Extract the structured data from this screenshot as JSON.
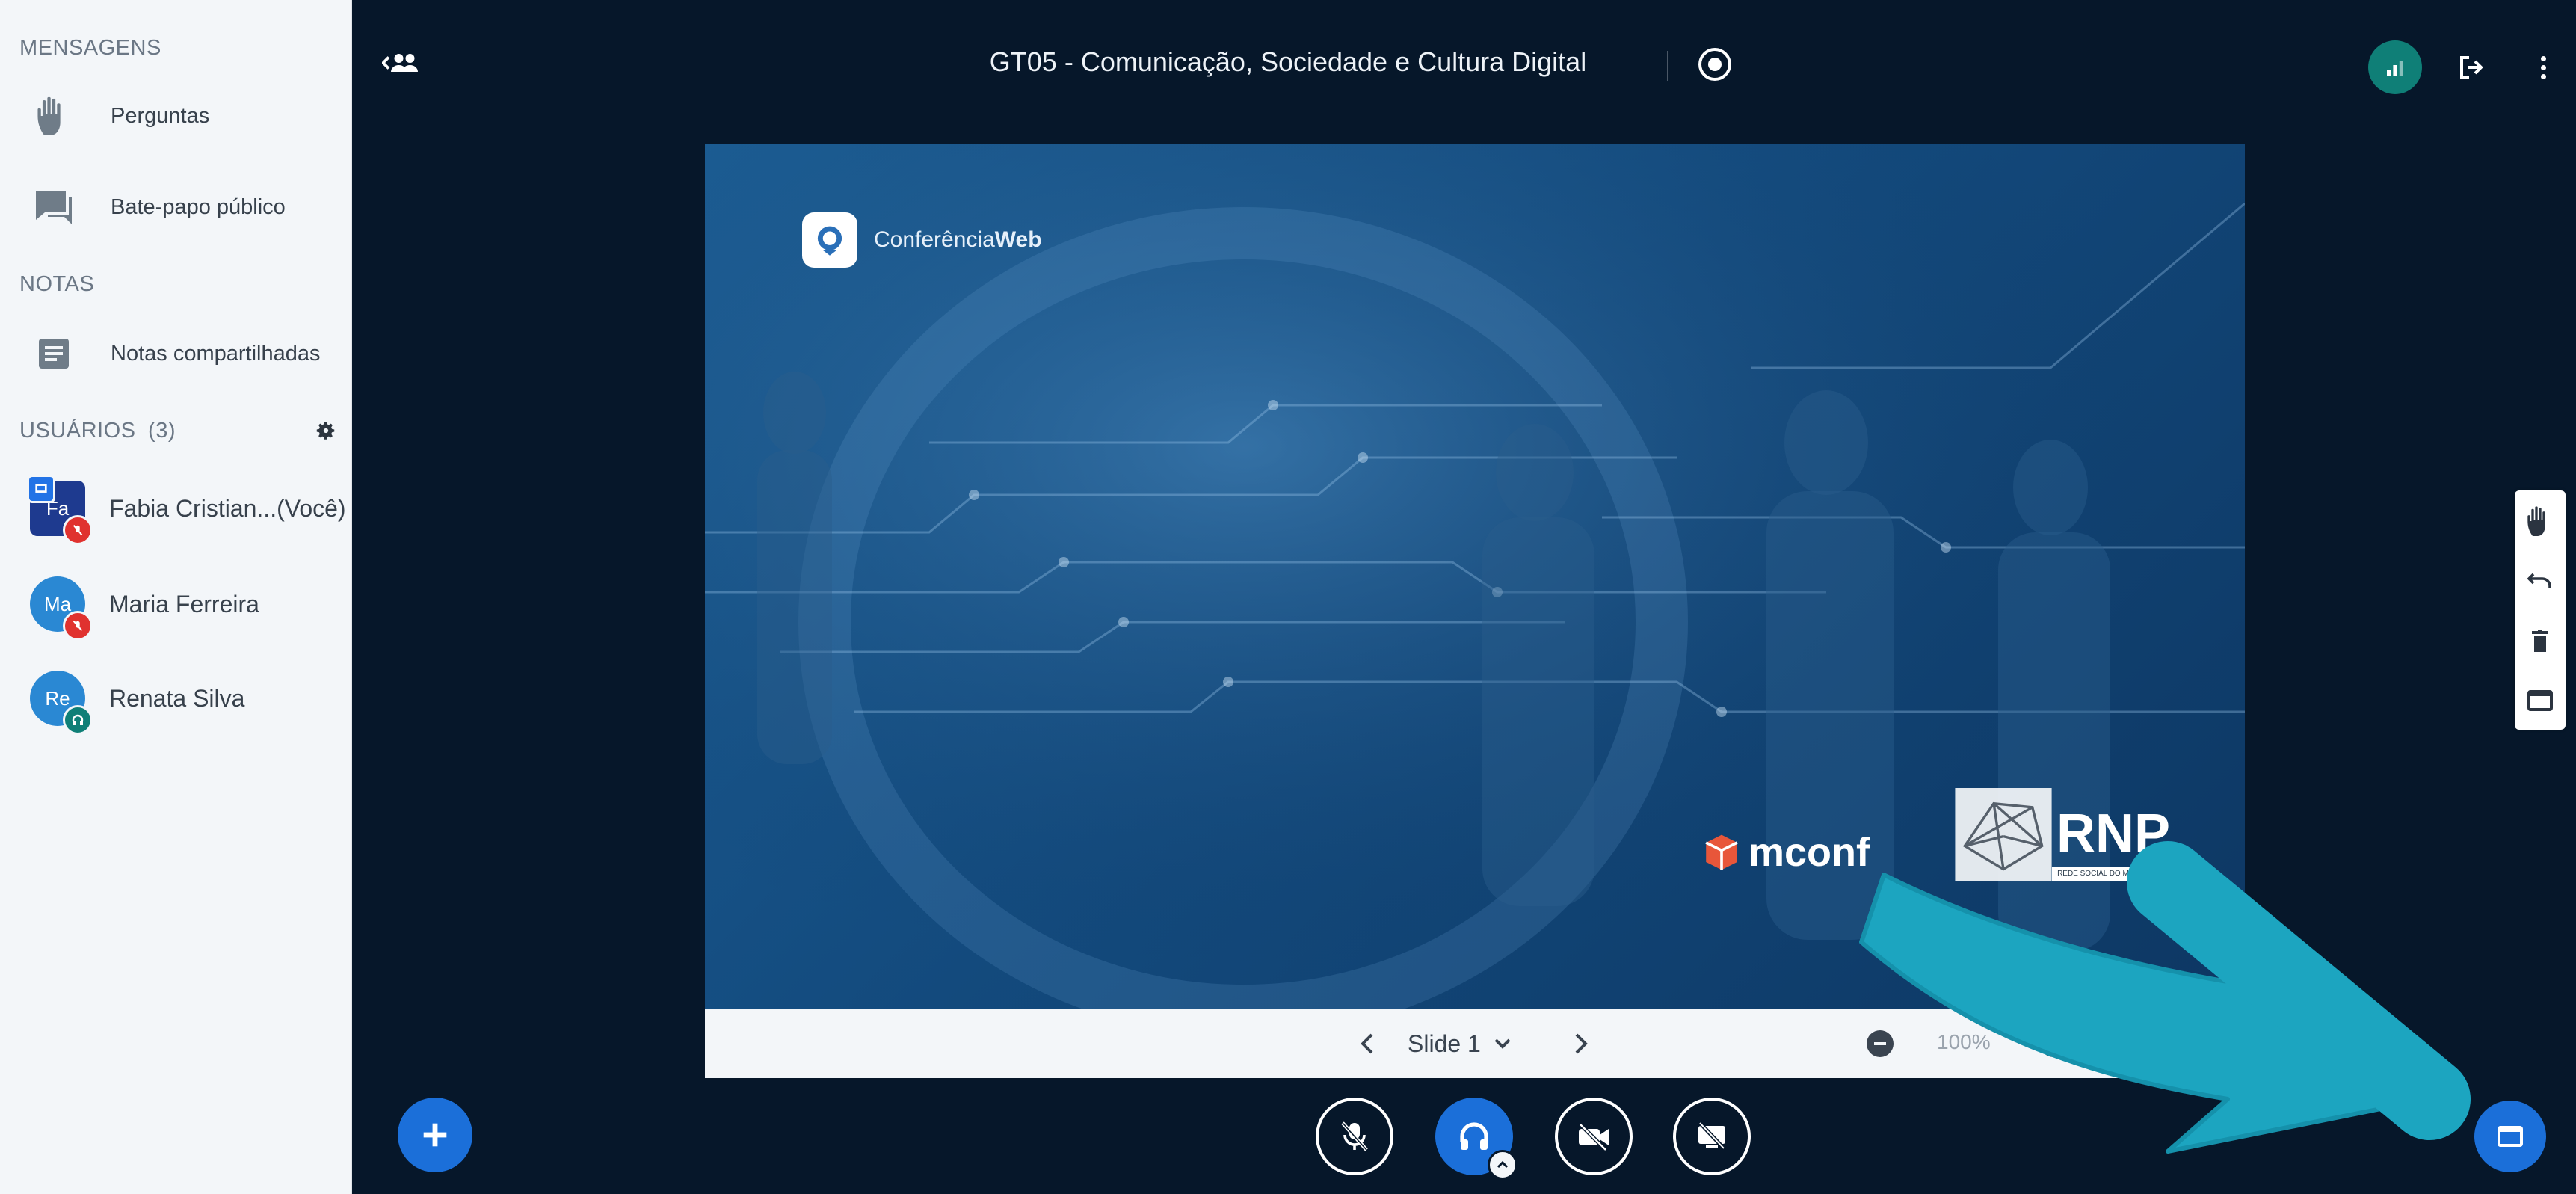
{
  "sidebar": {
    "messages_title": "MENSAGENS",
    "questions_label": "Perguntas",
    "public_chat_label": "Bate-papo público",
    "notes_title": "NOTAS",
    "shared_notes_label": "Notas compartilhadas",
    "users_title": "USUÁRIOS",
    "users_count": "(3)",
    "users": [
      {
        "initials": "Fa",
        "name": "Fabia Cristian...(Você)",
        "avatar_color": "#1e3a8f",
        "status": "muted"
      },
      {
        "initials": "Ma",
        "name": "Maria Ferreira",
        "avatar_color": "#2a88d3",
        "status": "muted"
      },
      {
        "initials": "Re",
        "name": "Renata Silva",
        "avatar_color": "#2a88d3",
        "status": "listen-only"
      }
    ]
  },
  "header": {
    "title": "GT05 - Comunicação, Sociedade e Cultura Digital",
    "recording_icon": "record-icon",
    "connection_icon": "connection-status-icon",
    "leave_icon": "leave-icon",
    "options_icon": "more-options-icon"
  },
  "slide": {
    "brand_text_light": "Conferência",
    "brand_text_bold": "Web",
    "mconf_text": "mconf",
    "rnp_text": "RNP",
    "rnp_tagline": "REDE SOCIAL DO MCTI"
  },
  "slide_toolbar": {
    "slide_label": "Slide 1",
    "zoom_value": "100%"
  },
  "controls": {
    "mic": "mic-muted-icon",
    "audio": "headphones-icon",
    "camera": "camera-off-icon",
    "screenshare": "screenshare-off-icon"
  },
  "colors": {
    "background": "#06172a",
    "sidebar": "#f3f6f9",
    "accent_blue": "#1b6fd9",
    "teal": "#0f7f77",
    "arrow": "#1ca5c0",
    "muted_red": "#e0322f"
  }
}
